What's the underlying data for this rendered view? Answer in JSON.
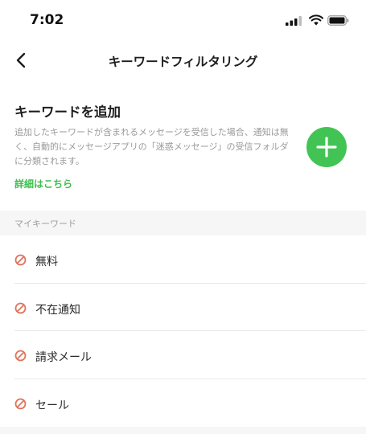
{
  "status_bar": {
    "time": "7:02",
    "icons": [
      "signal-icon",
      "wifi-icon",
      "battery-icon"
    ]
  },
  "nav": {
    "back_icon": "chevron-left-icon",
    "title": "キーワードフィルタリング"
  },
  "add_section": {
    "title": "キーワードを追加",
    "description": "追加したキーワードが含まれるメッセージを受信した場合、通知は無く、自動的にメッセージアプリの「迷惑メッセージ」の受信フォルダに分類されます。",
    "details_link": "詳細はこちら",
    "add_button_icon": "plus-icon"
  },
  "my_keywords": {
    "header": "マイキーワード",
    "items": [
      {
        "label": "無料"
      },
      {
        "label": "不在通知"
      },
      {
        "label": "請求メール"
      },
      {
        "label": "セール"
      }
    ]
  },
  "colors": {
    "accent_green": "#41c454",
    "link_green": "#3fbf4f",
    "block_icon": "#e0735a",
    "section_bg": "#f6f6f6"
  }
}
